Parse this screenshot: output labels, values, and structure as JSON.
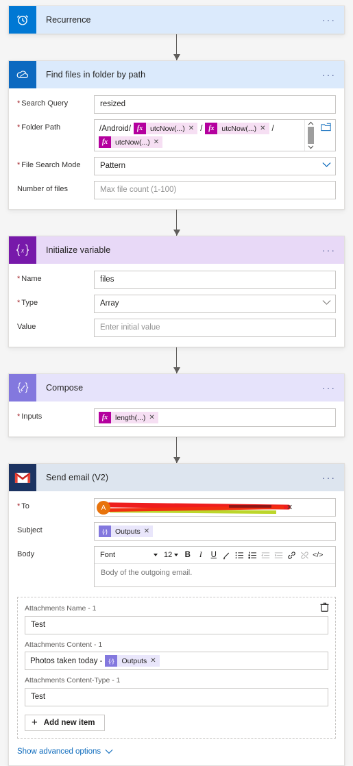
{
  "flow": {
    "steps": [
      {
        "id": "recurrence",
        "title": "Recurrence",
        "icon": "alarm-clock-icon",
        "more_label": "···"
      },
      {
        "id": "find-files",
        "title": "Find files in folder by path",
        "icon": "onedrive-cloud-icon",
        "more_label": "···",
        "fields": {
          "search_query": {
            "label": "Search Query",
            "required": true,
            "value": "resized"
          },
          "folder_path": {
            "label": "Folder Path",
            "required": true,
            "prefix": "/Android/",
            "tokens": [
              "utcNow(...)",
              "utcNow(...)",
              "utcNow(...)"
            ],
            "separator": "/",
            "trailing": "/"
          },
          "file_search_mode": {
            "label": "File Search Mode",
            "required": true,
            "value": "Pattern"
          },
          "number_of_files": {
            "label": "Number of files",
            "required": false,
            "placeholder": "Max file count (1-100)"
          }
        }
      },
      {
        "id": "initialize-variable",
        "title": "Initialize variable",
        "icon": "variable-braces-icon",
        "more_label": "···",
        "fields": {
          "name": {
            "label": "Name",
            "required": true,
            "value": "files"
          },
          "type": {
            "label": "Type",
            "required": true,
            "value": "Array"
          },
          "value": {
            "label": "Value",
            "required": false,
            "placeholder": "Enter initial value"
          }
        }
      },
      {
        "id": "compose",
        "title": "Compose",
        "icon": "compose-pencil-icon",
        "more_label": "···",
        "fields": {
          "inputs": {
            "label": "Inputs",
            "required": true,
            "token": "length(...)"
          }
        }
      },
      {
        "id": "send-email",
        "title": "Send email (V2)",
        "icon": "gmail-icon",
        "more_label": "···",
        "fields": {
          "to": {
            "label": "To",
            "required": true,
            "avatar_initial": "A",
            "value_redacted": true
          },
          "subject": {
            "label": "Subject",
            "required": false,
            "token": "Outputs"
          },
          "body": {
            "label": "Body",
            "required": false,
            "placeholder": "Body of the outgoing email."
          }
        },
        "editor": {
          "font_name": "Font",
          "font_size": "12",
          "buttons": [
            {
              "name": "bold-button",
              "glyph": "B",
              "dim": false
            },
            {
              "name": "italic-button",
              "glyph": "I",
              "dim": false
            },
            {
              "name": "underline-button",
              "glyph": "U",
              "dim": false
            },
            {
              "name": "text-color-button",
              "glyph": "✎",
              "dim": false
            },
            {
              "name": "bulleted-list-button",
              "glyph": "≡",
              "dim": false
            },
            {
              "name": "numbered-list-button",
              "glyph": "≡",
              "dim": false
            },
            {
              "name": "decrease-indent-button",
              "glyph": "≡",
              "dim": true
            },
            {
              "name": "increase-indent-button",
              "glyph": "≡",
              "dim": true
            },
            {
              "name": "insert-link-button",
              "glyph": "🔗",
              "dim": false
            },
            {
              "name": "remove-link-button",
              "glyph": "🔗",
              "dim": true
            },
            {
              "name": "code-view-button",
              "glyph": "</>",
              "dim": false
            }
          ]
        },
        "attachments": {
          "delete_icon": "delete-trash-icon",
          "items": [
            {
              "label": "Attachments Name - 1",
              "value": "Test"
            },
            {
              "label": "Attachments Content - 1",
              "prefix": "Photos taken today -",
              "token": "Outputs"
            },
            {
              "label": "Attachments Content-Type - 1",
              "value": "Test"
            }
          ],
          "add_label": "Add new item"
        },
        "advanced_label": "Show advanced options"
      }
    ]
  },
  "colors": {
    "page_bg": "#f5f5f5",
    "header_blue": "#dbeafc",
    "header_purple": "#e8d9f7",
    "header_lavender": "#e6e3fb",
    "header_gray": "#dde5ef",
    "icon_recurrence": "#0078d4",
    "icon_onedrive": "#0c69c0",
    "icon_initvar": "#7719aa",
    "icon_compose": "#8378de",
    "icon_gmail": "#1c3361",
    "token_fx": "#b4009e",
    "token_out": "#8378de",
    "link": "#0f6cbd",
    "required_asterisk": "#a4262c",
    "avatar": "#e8730c"
  }
}
